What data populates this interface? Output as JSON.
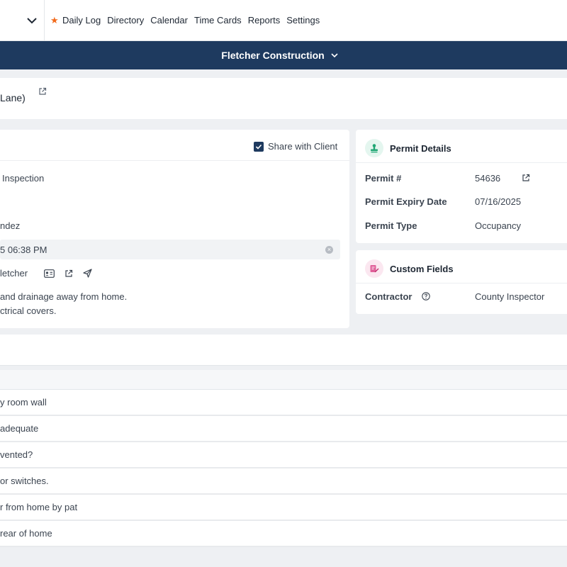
{
  "nav": {
    "links": [
      "Daily Log",
      "Directory",
      "Calendar",
      "Time Cards",
      "Reports",
      "Settings"
    ],
    "favorite_index": 0,
    "accent": "#f26a1b"
  },
  "project": {
    "name": "Fletcher Construction",
    "bar_color": "#1e3a5f"
  },
  "page": {
    "title_fragment": "Lane)"
  },
  "inspection": {
    "share_label": "Share with Client",
    "share_checked": true,
    "type_fragment": "Inspection",
    "inspector_fragment": "ndez",
    "date_fragment": "5 06:38 PM",
    "contact_fragment": "letcher",
    "notes_line1": "and drainage away from home.",
    "notes_line2": "ctrical covers."
  },
  "permit": {
    "title": "Permit Details",
    "rows": [
      {
        "label": "Permit #",
        "value": "54636"
      },
      {
        "label": "Permit Expiry Date",
        "value": "07/16/2025"
      },
      {
        "label": "Permit Type",
        "value": "Occupancy"
      }
    ]
  },
  "custom_fields": {
    "title": "Custom Fields",
    "rows": [
      {
        "label": "Contractor",
        "value": "County Inspector"
      }
    ]
  },
  "checklist": {
    "items": [
      "y room wall",
      "adequate",
      "vented?",
      "or switches.",
      "r from home by pat",
      "rear of home"
    ]
  }
}
